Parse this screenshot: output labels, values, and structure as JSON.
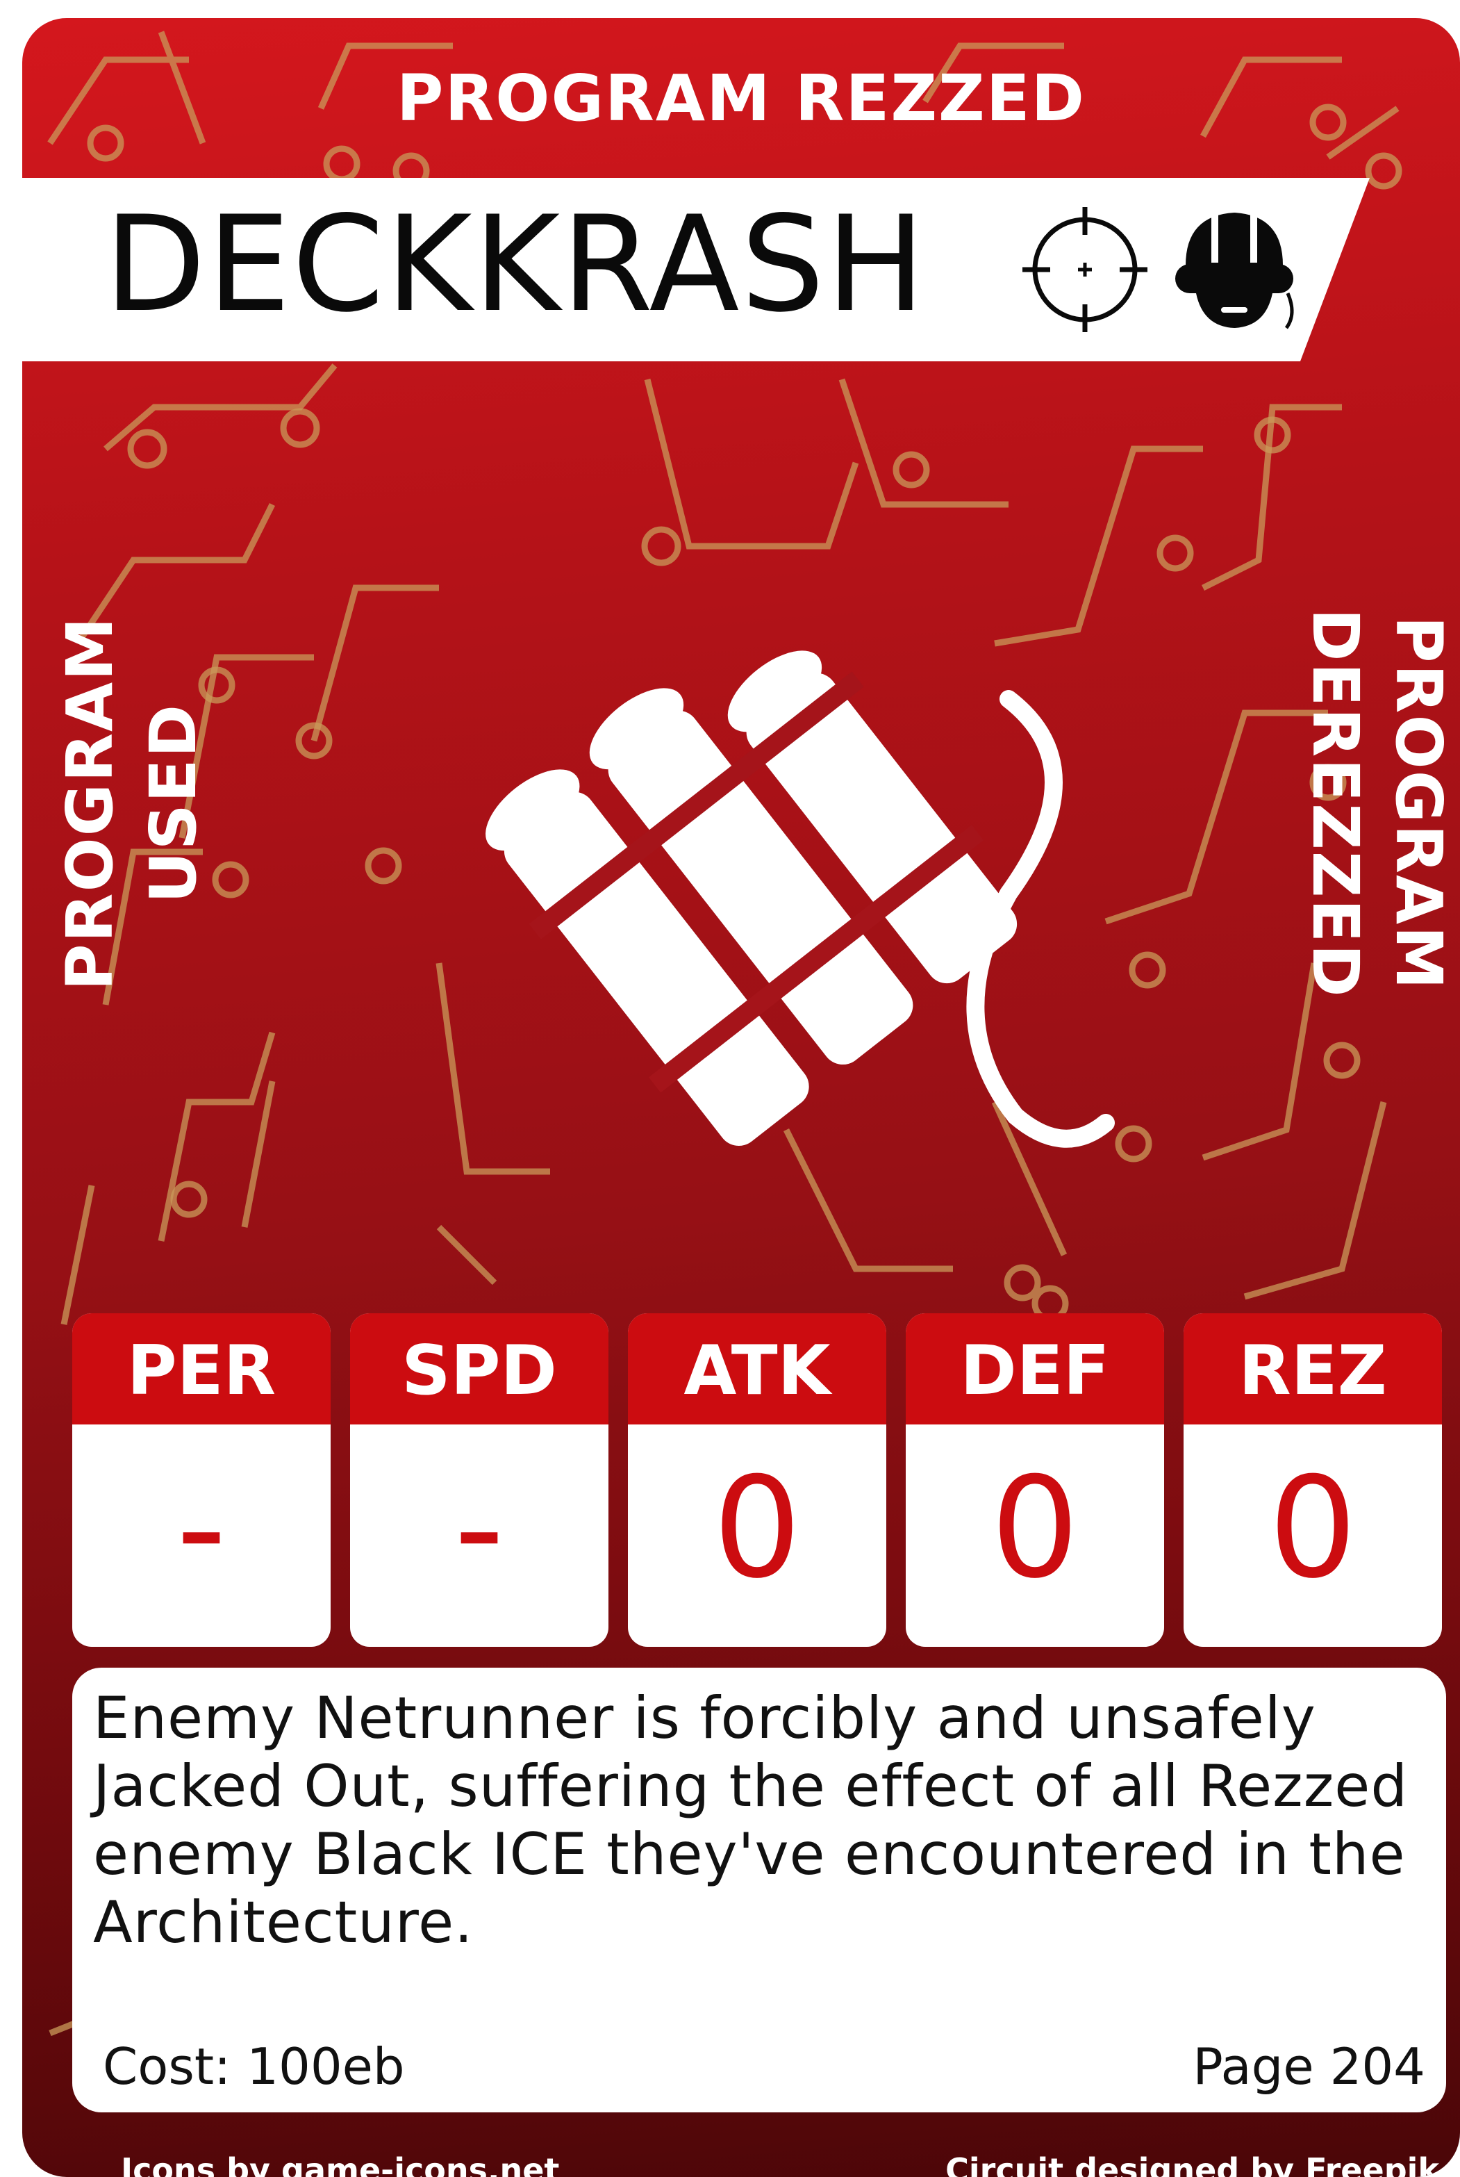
{
  "card": {
    "top_label": "PROGRAM REZZED",
    "title": "DECKKRASH",
    "left_label": "PROGRAM USED",
    "right_label": "PROGRAM DEREZZED",
    "icons": {
      "class_icon": "crosshair-icon",
      "type_icon": "netrunner-helmet-icon",
      "art_icon": "dynamite-icon"
    },
    "stats": [
      {
        "label": "PER",
        "value": "-"
      },
      {
        "label": "SPD",
        "value": "-"
      },
      {
        "label": "ATK",
        "value": "0"
      },
      {
        "label": "DEF",
        "value": "0"
      },
      {
        "label": "REZ",
        "value": "0"
      }
    ],
    "description": "Enemy Netrunner is forcibly and unsafely Jacked Out, suffering the effect of all Rezzed enemy Black ICE they've encountered in the Architecture.",
    "cost": "Cost: 100eb",
    "page": "Page 204",
    "credits": {
      "left": "Icons by game-icons.net",
      "right": "Circuit designed by Freepik"
    },
    "colors": {
      "card_red": "#cc0c10",
      "circuit_gold": "#c9995a",
      "text_white": "#ffffff"
    }
  }
}
